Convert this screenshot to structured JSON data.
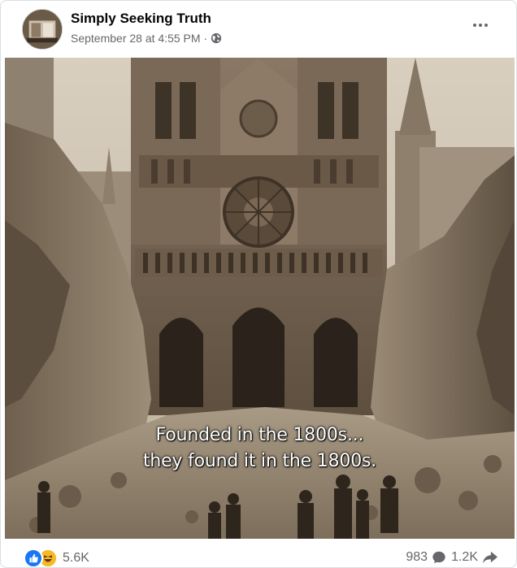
{
  "post": {
    "author": "Simply Seeking Truth",
    "timestamp": "September 28 at 4:55 PM",
    "separator": "·",
    "privacy_icon": "globe-icon",
    "more_icon": "more-horizontal-icon"
  },
  "image": {
    "caption_line1": "Founded in the 1800s...",
    "caption_line2": "they found it in the 1800s."
  },
  "footer": {
    "reactions": [
      "like-icon",
      "haha-icon"
    ],
    "reaction_count": "5.6K",
    "comment_count": "983",
    "share_count": "1.2K"
  },
  "colors": {
    "like": "#1877f2",
    "haha": "#f7b928",
    "secondary_text": "#65676b"
  }
}
